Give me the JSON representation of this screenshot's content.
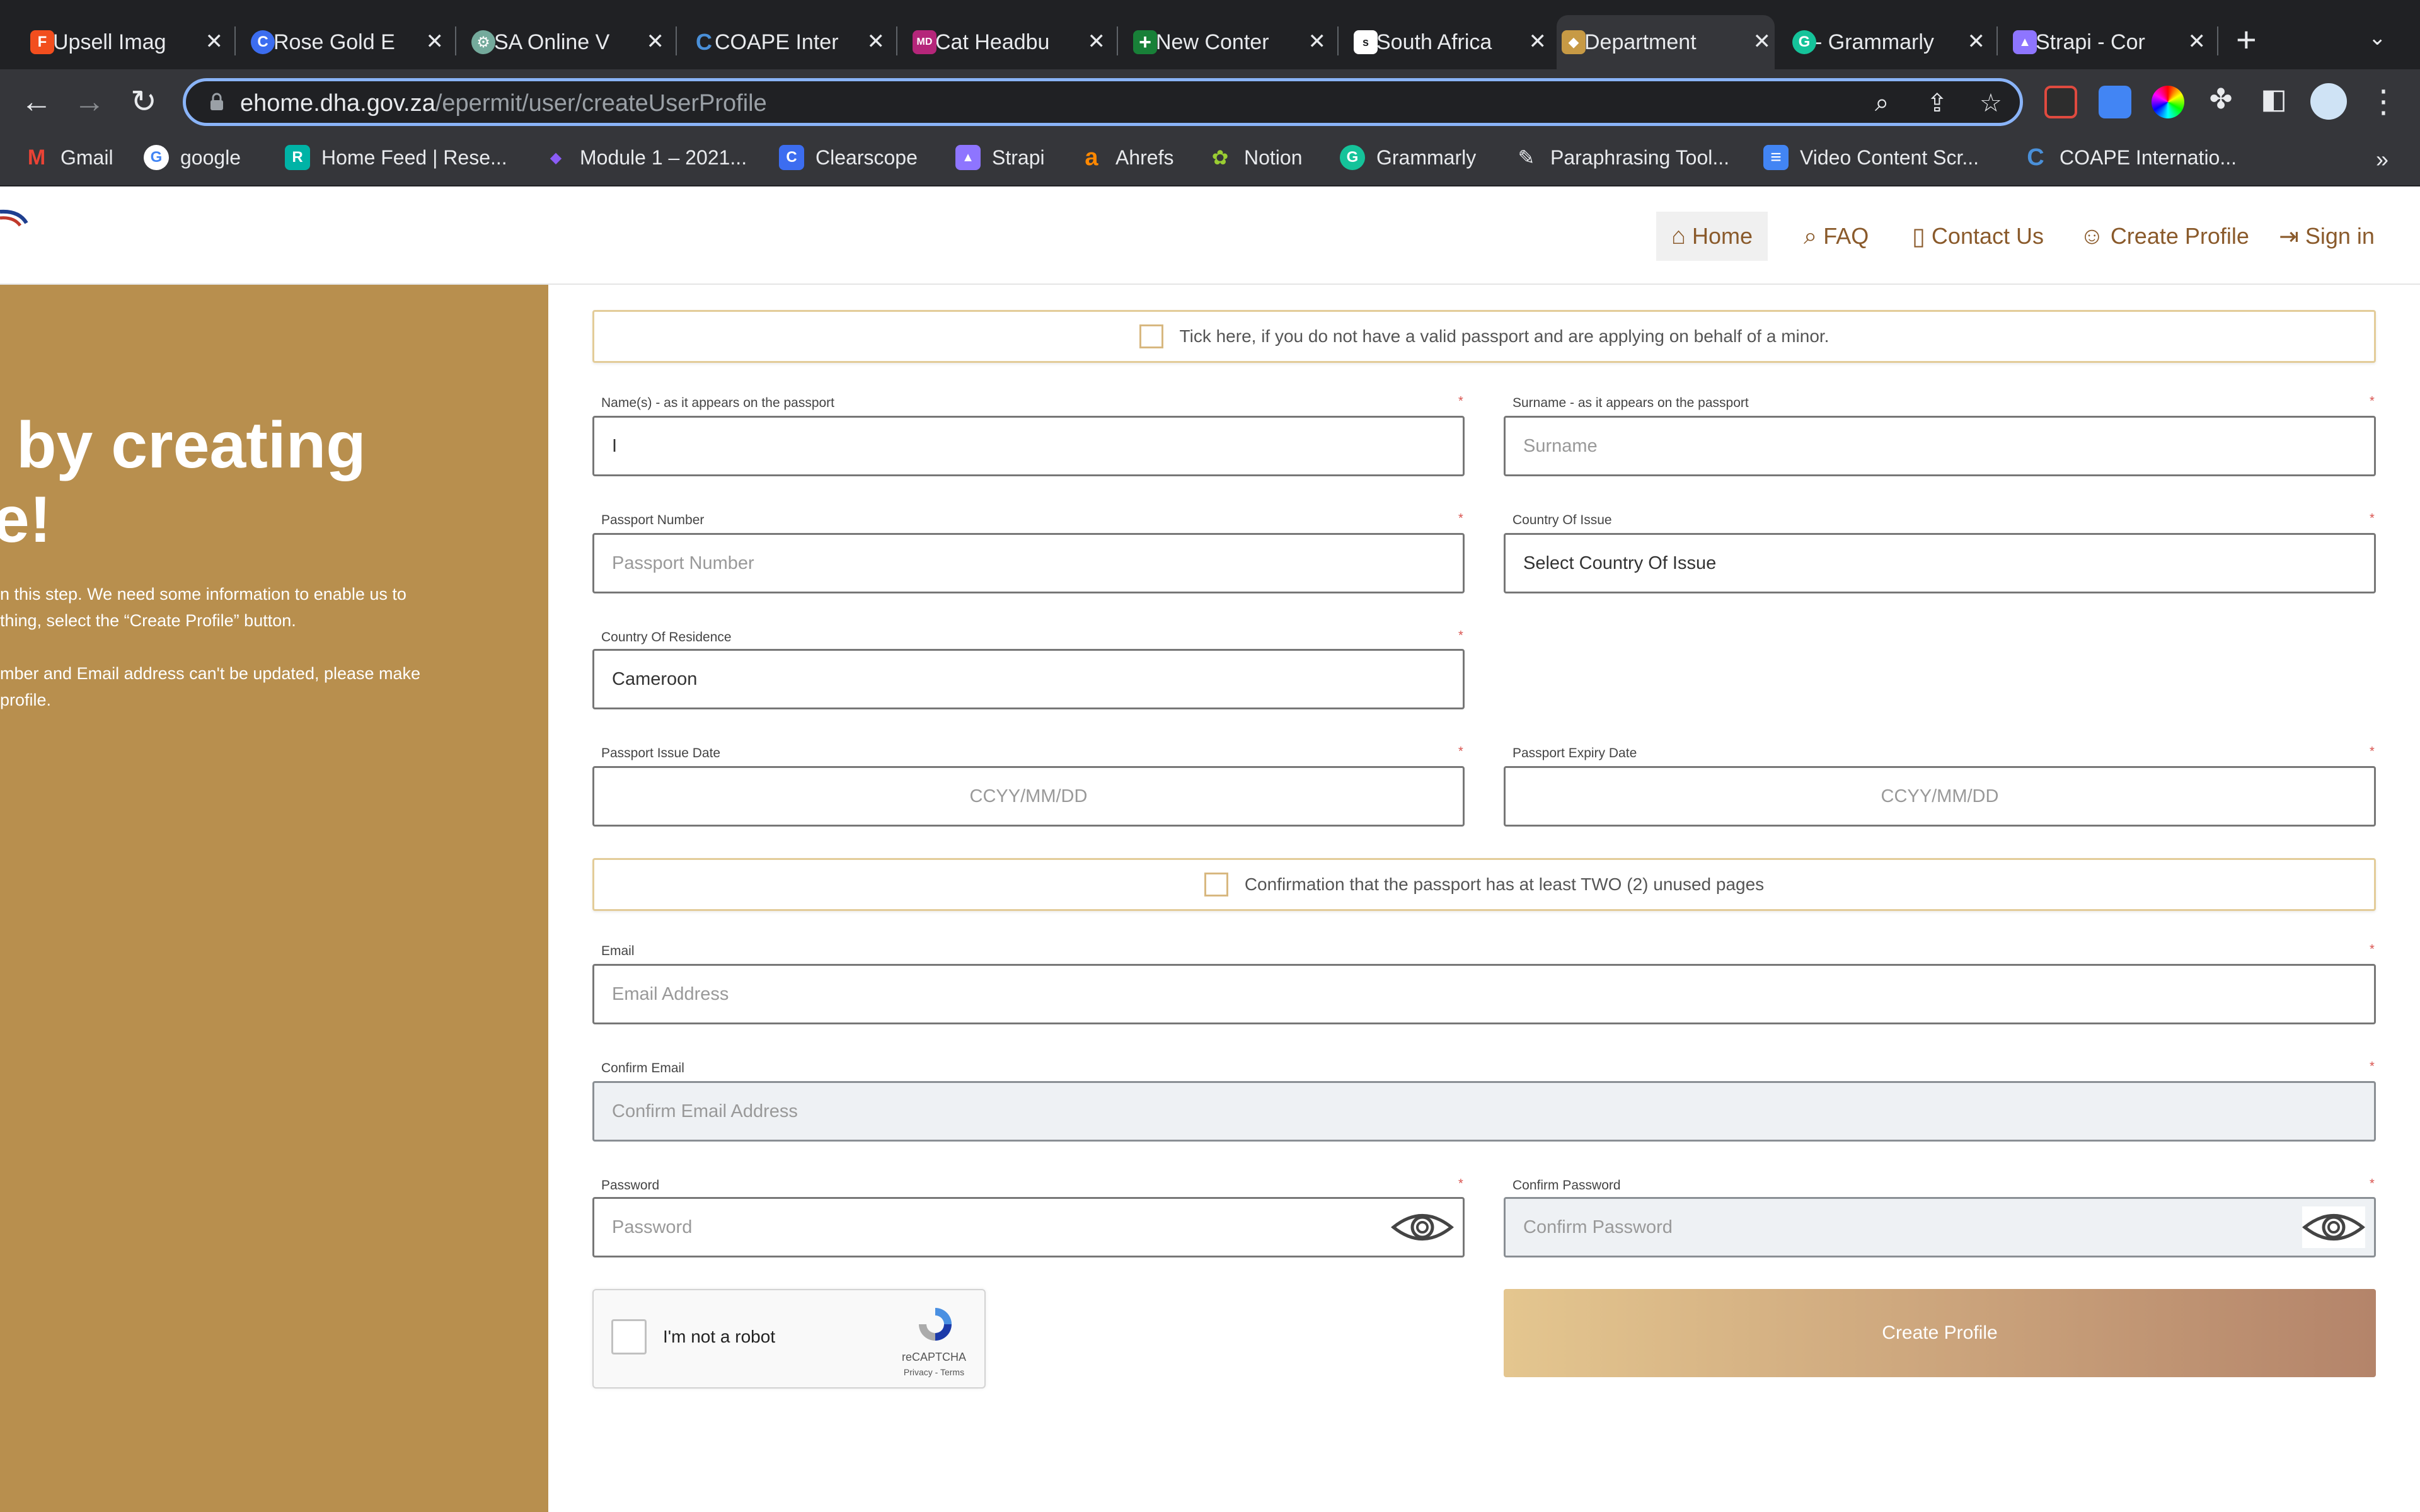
{
  "browser": {
    "tabs": [
      {
        "title": "Upsell Imag",
        "fav_color": "#f24e1e",
        "fav_glyph": "F"
      },
      {
        "title": "Rose Gold E",
        "fav_color": "#3c6df0",
        "fav_glyph": "C"
      },
      {
        "title": "SA Online V",
        "fav_color": "#74aa9c",
        "fav_glyph": "⚙"
      },
      {
        "title": "COAPE Inter",
        "fav_color": "#4a90d9",
        "fav_glyph": "C"
      },
      {
        "title": "Cat Headbu",
        "fav_color": "#b5267a",
        "fav_glyph": "MD"
      },
      {
        "title": "New Conter",
        "fav_color": "#188038",
        "fav_glyph": "+"
      },
      {
        "title": "South Africa",
        "fav_color": "#ffffff",
        "fav_glyph": "s"
      },
      {
        "title": "Department",
        "fav_color": "#c79a45",
        "fav_glyph": "◆"
      },
      {
        "title": "- Grammarly",
        "fav_color": "#15c39a",
        "fav_glyph": "G"
      },
      {
        "title": "Strapi - Cor",
        "fav_color": "#8e75ff",
        "fav_glyph": "▲"
      }
    ],
    "close_glyph": "✕",
    "new_tab_glyph": "+",
    "tab_menu_glyph": "⌄",
    "url_host": "ehome.dha.gov.za",
    "url_path": "/epermit/user/createUserProfile",
    "bookmarks": [
      {
        "label": "Gmail",
        "color": "#ea4335",
        "glyph": "M"
      },
      {
        "label": "google",
        "color": "#4285f4",
        "glyph": "G"
      },
      {
        "label": "Home Feed | Rese...",
        "color": "#00b3a6",
        "glyph": "R"
      },
      {
        "label": "Module 1 – 2021...",
        "color": "#8b5cf6",
        "glyph": "◆"
      },
      {
        "label": "Clearscope",
        "color": "#3c6df0",
        "glyph": "C"
      },
      {
        "label": "Strapi",
        "color": "#8e75ff",
        "glyph": "▲"
      },
      {
        "label": "Ahrefs",
        "color": "#ff8800",
        "glyph": "a"
      },
      {
        "label": "Notion",
        "color": "#6b8e23",
        "glyph": "✿"
      },
      {
        "label": "Grammarly",
        "color": "#15c39a",
        "glyph": "G"
      },
      {
        "label": "Paraphrasing Tool...",
        "color": "#555555",
        "glyph": "✎"
      },
      {
        "label": "Video Content Scr...",
        "color": "#4285f4",
        "glyph": "≡"
      },
      {
        "label": "COAPE Internatio...",
        "color": "#4a90d9",
        "glyph": "C"
      }
    ],
    "bookmarks_more": "»"
  },
  "header": {
    "nav": [
      {
        "label": "Home",
        "icon": "home-icon",
        "glyph": "⌂"
      },
      {
        "label": "FAQ",
        "icon": "search-icon",
        "glyph": "⌕"
      },
      {
        "label": "Contact Us",
        "icon": "phone-icon",
        "glyph": "▯"
      },
      {
        "label": "Create Profile",
        "icon": "user-icon",
        "glyph": "☺"
      },
      {
        "label": "Sign in",
        "icon": "sign-in-icon",
        "glyph": "⇥"
      }
    ]
  },
  "left_panel": {
    "heading_line1": "by creating",
    "heading_line2": "le!",
    "para1_line1": "n this step. We need some information to enable us to",
    "para1_line2": "thing, select the “Create Profile” button.",
    "para2_line1": "mber and Email address can't be updated, please make",
    "para2_line2": " profile."
  },
  "form": {
    "minor_notice": "Tick here, if you do not have a valid passport and are applying on behalf of a minor.",
    "names_label": "Name(s) - as it appears on the passport",
    "names_value": "I",
    "surname_label": "Surname - as it appears on the passport",
    "surname_placeholder": "Surname",
    "passport_number_label": "Passport Number",
    "passport_number_placeholder": "Passport Number",
    "country_issue_label": "Country Of Issue",
    "country_issue_value": "Select Country Of Issue",
    "country_residence_label": "Country Of Residence",
    "country_residence_value": "Cameroon",
    "issue_date_label": "Passport Issue Date",
    "issue_date_placeholder": "CCYY/MM/DD",
    "expiry_date_label": "Passport Expiry Date",
    "expiry_date_placeholder": "CCYY/MM/DD",
    "pages_confirm": "Confirmation that the passport has at least TWO (2) unused pages",
    "email_label": "Email",
    "email_placeholder": "Email Address",
    "confirm_email_label": "Confirm Email",
    "confirm_email_placeholder": "Confirm Email Address",
    "password_label": "Password",
    "password_placeholder": "Password",
    "confirm_password_label": "Confirm Password",
    "confirm_password_placeholder": "Confirm Password",
    "required_marker": "*",
    "recaptcha_label": "I'm not a robot",
    "recaptcha_brand": "reCAPTCHA",
    "recaptcha_terms": "Privacy - Terms",
    "submit_label": "Create Profile"
  }
}
